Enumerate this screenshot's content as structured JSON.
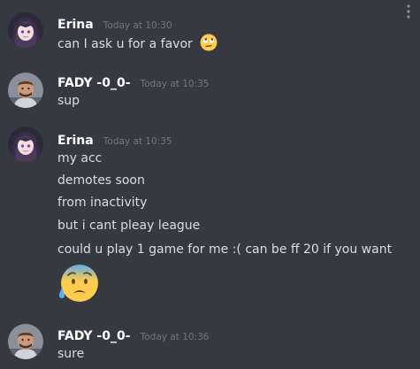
{
  "messages": [
    {
      "username": "Erina",
      "timestamp": "Today at 10:30",
      "lines": [
        "can I ask u for a favor"
      ],
      "inline_emoji": "rolling-eyes-emoji"
    },
    {
      "username": "FADY -0_0-",
      "timestamp": "Today at 10:35",
      "lines": [
        "sup"
      ]
    },
    {
      "username": "Erina",
      "timestamp": "Today at 10:35",
      "lines": [
        "my acc",
        "demotes soon",
        "from inactivity",
        "but i cant pleay league",
        "could u play 1 game for me :( can be ff 20 if you want"
      ],
      "big_emoji": "anxious-face-with-sweat-emoji"
    },
    {
      "username": "FADY -0_0-",
      "timestamp": "Today at 10:36",
      "lines": [
        "sure"
      ]
    }
  ],
  "colors": {
    "background": "#36393f",
    "username": "#ffffff",
    "timestamp": "#72767d",
    "text": "#dcddde"
  }
}
